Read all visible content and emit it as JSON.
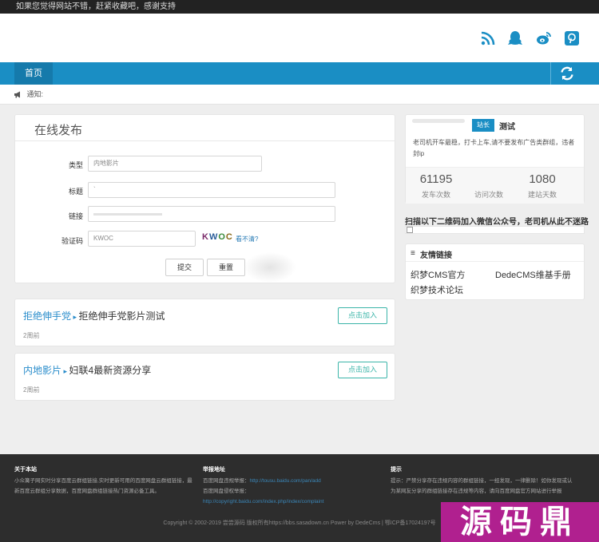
{
  "topbar": {
    "text": "如果您觉得网站不错，赶紧收藏吧，感谢支持"
  },
  "header": {
    "social_icons": [
      "rss-icon",
      "qq-icon",
      "weibo-icon",
      "pinterest-icon"
    ],
    "accent": "#1a8ec4"
  },
  "nav": {
    "home": "首页",
    "refresh_icon": "refresh-icon"
  },
  "notice": {
    "label": "通知:"
  },
  "form": {
    "title": "在线发布",
    "type_label": "类型",
    "type_value": "内地影片",
    "title_label": "标题",
    "title_value": "`",
    "link_label": "链接",
    "captcha_label": "验证码",
    "captcha_value": "KWOC",
    "captcha_image_text": "KWOC",
    "captcha_refresh": "看不清?",
    "submit": "提交",
    "reset": "重置"
  },
  "groups": [
    {
      "category": "拒绝伸手党",
      "name": "拒绝伸手党影片测试",
      "time": "2周前",
      "join": "点击加入"
    },
    {
      "category": "内地影片",
      "name": "妇联4最新资源分享",
      "time": "2周前",
      "join": "点击加入"
    }
  ],
  "profile": {
    "badge": "站长",
    "name": "测试",
    "description": "老司机开车最稳，打卡上车,请不要发布广告类群组，违者封ip",
    "stats": [
      {
        "value": "61195",
        "label": "发车次数"
      },
      {
        "value": "",
        "label": "访问次数"
      },
      {
        "value": "1080",
        "label": "建站天数"
      }
    ]
  },
  "qr": {
    "text": "扫描以下二维码加入微信公众号，老司机从此不迷路"
  },
  "links": {
    "title": "友情链接",
    "items": [
      "织梦CMS官方",
      "DedeCMS维基手册",
      "织梦技术论坛"
    ]
  },
  "footer": {
    "about_title": "关于本站",
    "about_text": "小众篝子网实时分享百度云群组链接,实时更新可用的百度网盘云群组链接，最新百度云群组分享数据，百度网盘群组链接热门资源必备工具。",
    "report_title": "举报地址",
    "report_1_label": "百度网盘违规举报：",
    "report_1_link": "http://tousu.baidu.com/pan/add",
    "report_2_label": "百度网盘侵权举报：",
    "report_2_link": "http://copyright.baidu.com/index.php/index/complaint",
    "tips_title": "提示",
    "tips_text": "提示：严禁分享存在违规内容的群组链接，一经发现，一律删除！如你发现或认为某网友分享的群组链接存在违规等内容，请向百度网盘官方网站进行举报",
    "copyright": "Copyright © 2002-2019 尝尝源码 版权所有https://bbs.sasadown.cn Power by DedeCms | 鄂ICP备17024197号"
  },
  "watermark": {
    "text": "源码鼎"
  }
}
